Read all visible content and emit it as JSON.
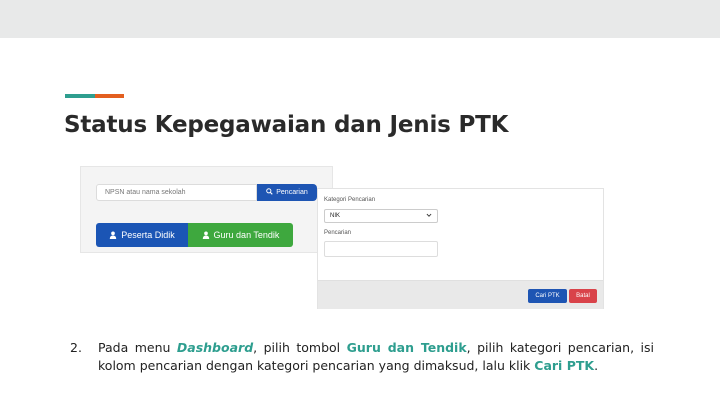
{
  "slide": {
    "title": "Status Kepegawaian dan Jenis PTK",
    "accent_colors": [
      "#2e9e8f",
      "#e35f1f"
    ]
  },
  "screenshot_search": {
    "search_placeholder": "NPSN atau nama sekolah",
    "search_button": "Pencarian",
    "tab_peserta": "Peserta Didik",
    "tab_guru": "Guru dan Tendik",
    "colors": {
      "primary": "#1e55b3",
      "success": "#3ea83e"
    }
  },
  "screenshot_form": {
    "category_label": "Kategori Pencarian",
    "category_value": "NIK",
    "search_label": "Pencarian",
    "search_value": "",
    "cari_button": "Cari PTK",
    "batal_button": "Batal",
    "colors": {
      "danger": "#d9434a"
    }
  },
  "instruction": {
    "number": "2.",
    "t1": "Pada menu ",
    "k1": "Dashboard",
    "t2": ", pilih tombol ",
    "k2": "Guru dan Tendik",
    "t3": ", pilih kategori pencarian, isi kolom pencarian dengan kategori pencarian yang dimaksud, lalu klik ",
    "k3": "Cari PTK",
    "t4": "."
  }
}
